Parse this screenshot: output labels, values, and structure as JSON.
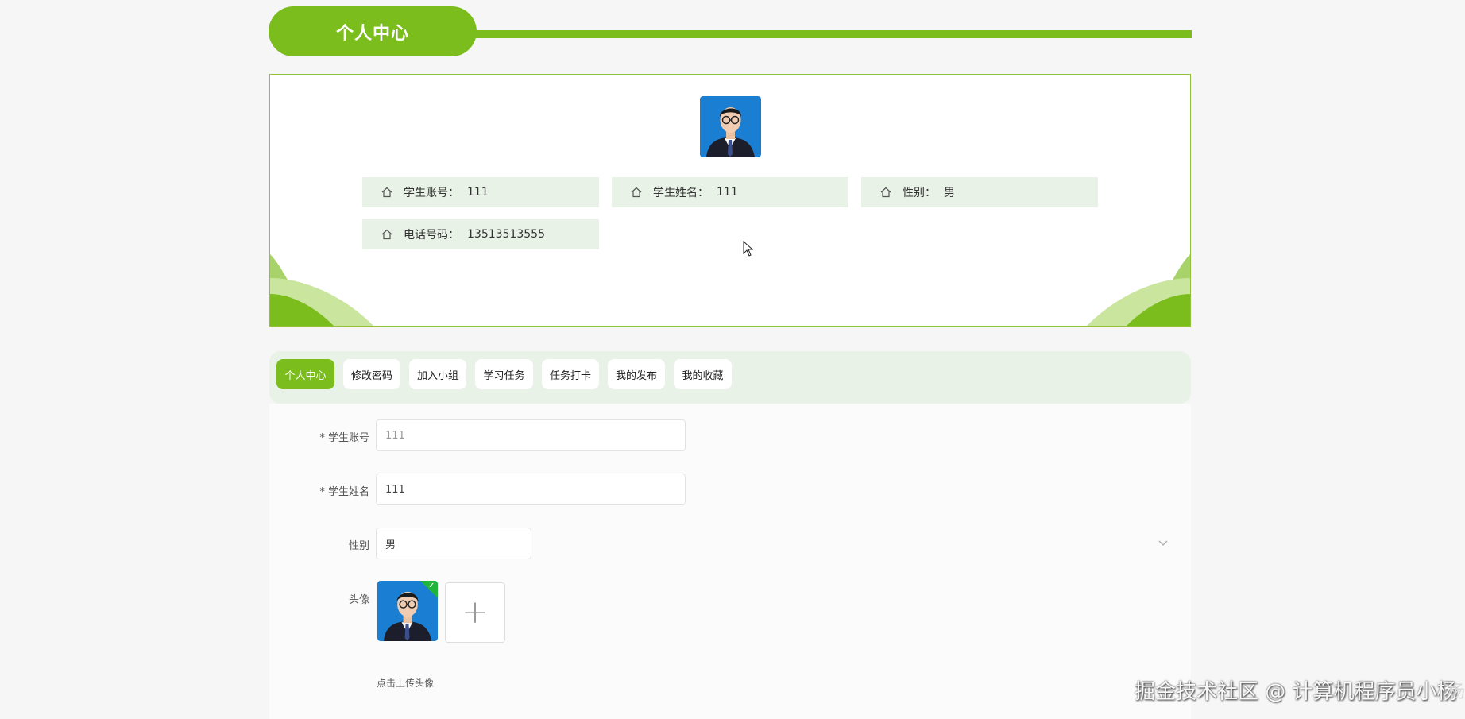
{
  "header": {
    "title": "个人中心"
  },
  "profile": {
    "fields": [
      {
        "label": "学生账号：",
        "value": "111"
      },
      {
        "label": "学生姓名：",
        "value": "111"
      },
      {
        "label": "性别：",
        "value": "男"
      },
      {
        "label": "电话号码：",
        "value": "13513513555"
      }
    ]
  },
  "tabs": [
    {
      "label": "个人中心",
      "active": true
    },
    {
      "label": "修改密码"
    },
    {
      "label": "加入小组"
    },
    {
      "label": "学习任务"
    },
    {
      "label": "任务打卡"
    },
    {
      "label": "我的发布"
    },
    {
      "label": "我的收藏"
    }
  ],
  "form": {
    "account": {
      "label": "* 学生账号",
      "value": "111"
    },
    "name": {
      "label": "* 学生姓名",
      "value": "111"
    },
    "gender": {
      "label": "性别",
      "value": "男"
    },
    "avatar": {
      "label": "头像",
      "hint": "点击上传头像"
    }
  },
  "watermark": "掘金技术社区 @ 计算机程序员小杨",
  "edge_text": "杨",
  "colors": {
    "accent": "#7bbd1c",
    "panel": "#e8f2e6"
  }
}
